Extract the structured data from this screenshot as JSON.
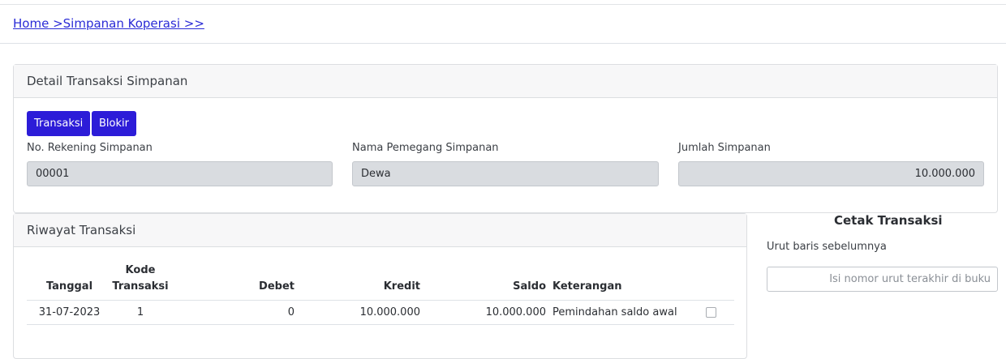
{
  "breadcrumb": {
    "home": "Home",
    "separator1": " >",
    "section": "Simpanan Koperasi",
    "separator2": " >>"
  },
  "detail": {
    "title": "Detail Transaksi Simpanan",
    "buttons": {
      "transaksi": "Transaksi",
      "blokir": "Blokir"
    },
    "fields": {
      "rekening_label": "No. Rekening Simpanan",
      "rekening_value": "00001",
      "nama_label": "Nama Pemegang Simpanan",
      "nama_value": "Dewa",
      "jumlah_label": "Jumlah Simpanan",
      "jumlah_value": "10.000.000"
    }
  },
  "riwayat": {
    "title": "Riwayat Transaksi",
    "columns": {
      "tanggal": "Tanggal",
      "kode_line1": "Kode",
      "kode_line2": "Transaksi",
      "debet": "Debet",
      "kredit": "Kredit",
      "saldo": "Saldo",
      "keterangan": "Keterangan"
    },
    "rows": [
      {
        "tanggal": "31-07-2023",
        "kode": "1",
        "debet": "0",
        "kredit": "10.000.000",
        "saldo": "10.000.000",
        "keterangan": "Pemindahan saldo awal",
        "checked": false
      }
    ]
  },
  "cetak": {
    "title": "Cetak Transaksi",
    "label": "Urut baris sebelumnya",
    "placeholder": "Isi nomor urut terakhir di buku"
  },
  "colors": {
    "primary_button": "#2c1cd8",
    "link": "#2a2bd6",
    "readonly_field": "#d9dce0"
  }
}
